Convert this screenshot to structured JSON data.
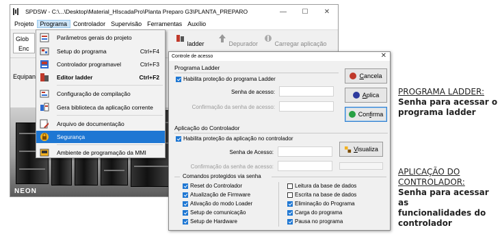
{
  "window": {
    "title": "SPDSW - C:\\...\\Desktop\\Material_HIscadaPro\\Planta Preparo G3\\PLANTA_PREPARO",
    "controls": [
      "—",
      "☐",
      "✕"
    ]
  },
  "menubar": [
    "Projeto",
    "Programa",
    "Controlador",
    "Supervisão",
    "Ferramentas",
    "Auxílio"
  ],
  "toolbar": {
    "tab_line1": "Glob",
    "tab_line2": "Enc",
    "ladder": "ladder",
    "depurador": "Depurador",
    "carregar": "Carregar aplicação"
  },
  "left_label": "Equipan",
  "panel_text": "NEON",
  "program_menu": {
    "items": [
      {
        "label": "Parâmetros gerais do projeto",
        "shortcut": "",
        "icon": "params-icon"
      },
      {
        "label": "Setup do programa",
        "shortcut": "Ctrl+F4",
        "icon": "setup-icon"
      },
      {
        "label": "Controlador programavel",
        "shortcut": "Ctrl+F3",
        "icon": "plc-icon"
      },
      {
        "label": "Editor ladder",
        "shortcut": "Ctrl+F2",
        "icon": "ladder-icon"
      },
      {
        "label": "Configuração de compilação",
        "shortcut": "",
        "icon": "compile-config-icon"
      },
      {
        "label": "Gera biblioteca da aplicação corrente",
        "shortcut": "",
        "icon": "library-icon"
      },
      {
        "label": "Arquivo de documentação",
        "shortcut": "",
        "icon": "doc-icon"
      },
      {
        "label": "Segurança",
        "shortcut": "",
        "icon": "lock-icon"
      },
      {
        "label": "Ambiente de programação da MMI",
        "shortcut": "",
        "icon": "mmi-icon"
      }
    ]
  },
  "dialog": {
    "title": "Controle de acesso",
    "ladder_section": "Programa Ladder",
    "ladder_protect": "Habilita proteção do programa Ladder",
    "ladder_pwd_label": "Senha de acesso:",
    "ladder_confirm_label": "Confirmação da senha de acesso:",
    "ctrl_section": "Aplicação do Controlador",
    "ctrl_protect": "Habilita proteção da aplicação no controlador",
    "ctrl_pwd_label": "Senha de Acesso:",
    "ctrl_confirm_label": "Confirmação da senha de acesso:",
    "cmd_section": "Comandos protegidos via senha",
    "cmds_left": [
      {
        "label": "Reset do Controlador",
        "checked": true
      },
      {
        "label": "Atualização de Firmware",
        "checked": true
      },
      {
        "label": "Ativação do modo Loader",
        "checked": true
      },
      {
        "label": "Setup de comunicação",
        "checked": true
      },
      {
        "label": "Setup de Hardware",
        "checked": true
      }
    ],
    "cmds_right": [
      {
        "label": "Leitura da base de dados",
        "checked": false
      },
      {
        "label": "Escrita na base de dados",
        "checked": false
      },
      {
        "label": "Eliminação do Programa",
        "checked": true
      },
      {
        "label": "Carga do programa",
        "checked": true
      },
      {
        "label": "Pausa no programa",
        "checked": true
      }
    ],
    "btn_cancel_u": "C",
    "btn_cancel_rest": "ancela",
    "btn_apply_u": "A",
    "btn_apply_rest": "plica",
    "btn_confirm_a": "Con",
    "btn_confirm_u": "f",
    "btn_confirm_b": "irma",
    "btn_view_u": "V",
    "btn_view_rest": "isualiza",
    "colors": {
      "cancel": "#c0392b",
      "apply": "#2e3b9e",
      "confirm": "#27a043",
      "accent": "#1e77d3"
    }
  },
  "annotations": {
    "ladder_heading": "PROGRAMA LADDER:",
    "ladder_text": [
      "Senha para acessar o",
      "programa ladder"
    ],
    "ctrl_heading": [
      "APLICAÇÃO DO",
      "CONTROLADOR:"
    ],
    "ctrl_text": [
      "Senha para acessar as",
      "funcionalidades do",
      "controlador"
    ]
  }
}
